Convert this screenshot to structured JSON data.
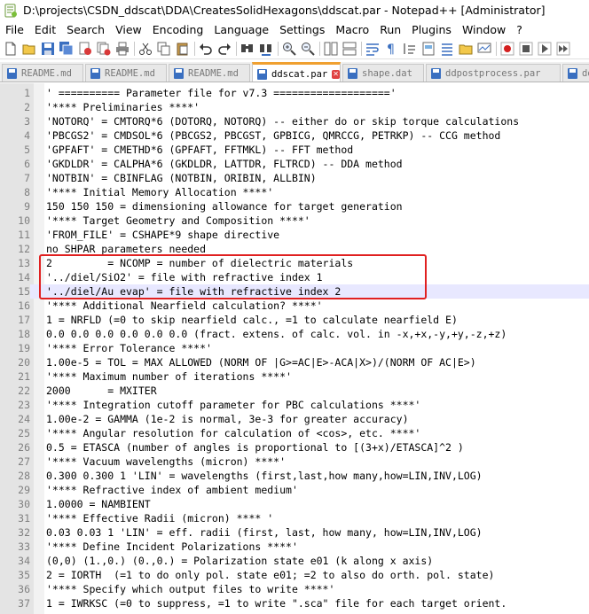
{
  "window": {
    "title": "D:\\projects\\CSDN_ddscat\\DDA\\CreatesSolidHexagons\\ddscat.par - Notepad++ [Administrator]"
  },
  "menu": [
    "File",
    "Edit",
    "Search",
    "View",
    "Encoding",
    "Language",
    "Settings",
    "Macro",
    "Run",
    "Plugins",
    "Window",
    "?"
  ],
  "toolbar": {
    "icons": [
      "new-file-icon",
      "open-file-icon",
      "save-icon",
      "save-all-icon",
      "close-icon",
      "close-all-icon",
      "print-icon",
      "cut-icon",
      "copy-icon",
      "paste-icon",
      "undo-icon",
      "redo-icon",
      "find-icon",
      "replace-icon",
      "zoom-in-icon",
      "zoom-out-icon",
      "sync-vertical-icon",
      "sync-horizontal-icon",
      "word-wrap-icon",
      "show-all-chars-icon",
      "indent-guide-icon",
      "document-map-icon",
      "function-list-icon",
      "folder-workspace-icon",
      "monitoring-icon",
      "record-macro-icon",
      "stop-record-icon",
      "play-macro-icon",
      "run-macro-multiple-icon",
      "save-macro-icon"
    ]
  },
  "tabs": [
    {
      "label": "README.md",
      "active": false
    },
    {
      "label": "README.md",
      "active": false
    },
    {
      "label": "README.md",
      "active": false
    },
    {
      "label": "ddscat.par",
      "active": true
    },
    {
      "label": "shape.dat",
      "active": false
    },
    {
      "label": "ddpostprocess.par",
      "active": false
    },
    {
      "label": "dds",
      "active": false
    }
  ],
  "editor": {
    "current_line": 15,
    "highlight_lines": [
      13,
      14,
      15
    ],
    "lines": [
      {
        "n": "1",
        "text": "' ========== Parameter file for v7.3 ==================='"
      },
      {
        "n": "2",
        "text": "'**** Preliminaries ****'"
      },
      {
        "n": "3",
        "text": "'NOTORQ' = CMTORQ*6 (DOTORQ, NOTORQ) -- either do or skip torque calculations"
      },
      {
        "n": "4",
        "text": "'PBCGS2' = CMDSOL*6 (PBCGS2, PBCGST, GPBICG, QMRCCG, PETRKP) -- CCG method"
      },
      {
        "n": "5",
        "text": "'GPFAFT' = CMETHD*6 (GPFAFT, FFTMKL) -- FFT method"
      },
      {
        "n": "6",
        "text": "'GKDLDR' = CALPHA*6 (GKDLDR, LATTDR, FLTRCD) -- DDA method"
      },
      {
        "n": "7",
        "text": "'NOTBIN' = CBINFLAG (NOTBIN, ORIBIN, ALLBIN)"
      },
      {
        "n": "8",
        "text": "'**** Initial Memory Allocation ****'"
      },
      {
        "n": "9",
        "text": "150 150 150 = dimensioning allowance for target generation"
      },
      {
        "n": "10",
        "text": "'**** Target Geometry and Composition ****'"
      },
      {
        "n": "11",
        "text": "'FROM_FILE' = CSHAPE*9 shape directive"
      },
      {
        "n": "12",
        "text": "no SHPAR parameters needed"
      },
      {
        "n": "13",
        "text": "2         = NCOMP = number of dielectric materials"
      },
      {
        "n": "14",
        "text": "'../diel/SiO2' = file with refractive index 1"
      },
      {
        "n": "15",
        "text": "'../diel/Au evap' = file with refractive index 2"
      },
      {
        "n": "16",
        "text": "'**** Additional Nearfield calculation? ****'"
      },
      {
        "n": "17",
        "text": "1 = NRFLD (=0 to skip nearfield calc., =1 to calculate nearfield E)"
      },
      {
        "n": "18",
        "text": "0.0 0.0 0.0 0.0 0.0 0.0 (fract. extens. of calc. vol. in -x,+x,-y,+y,-z,+z)"
      },
      {
        "n": "19",
        "text": "'**** Error Tolerance ****'"
      },
      {
        "n": "20",
        "text": "1.00e-5 = TOL = MAX ALLOWED (NORM OF |G>=AC|E>-ACA|X>)/(NORM OF AC|E>)"
      },
      {
        "n": "21",
        "text": "'**** Maximum number of iterations ****'"
      },
      {
        "n": "22",
        "text": "2000      = MXITER"
      },
      {
        "n": "23",
        "text": "'**** Integration cutoff parameter for PBC calculations ****'"
      },
      {
        "n": "24",
        "text": "1.00e-2 = GAMMA (1e-2 is normal, 3e-3 for greater accuracy)"
      },
      {
        "n": "25",
        "text": "'**** Angular resolution for calculation of <cos>, etc. ****'"
      },
      {
        "n": "26",
        "text": "0.5 = ETASCA (number of angles is proportional to [(3+x)/ETASCA]^2 )"
      },
      {
        "n": "27",
        "text": "'**** Vacuum wavelengths (micron) ****'"
      },
      {
        "n": "28",
        "text": "0.300 0.300 1 'LIN' = wavelengths (first,last,how many,how=LIN,INV,LOG)"
      },
      {
        "n": "29",
        "text": "'**** Refractive index of ambient medium'"
      },
      {
        "n": "30",
        "text": "1.0000 = NAMBIENT"
      },
      {
        "n": "31",
        "text": "'**** Effective Radii (micron) **** '"
      },
      {
        "n": "32",
        "text": "0.03 0.03 1 'LIN' = eff. radii (first, last, how many, how=LIN,INV,LOG)"
      },
      {
        "n": "33",
        "text": "'**** Define Incident Polarizations ****'"
      },
      {
        "n": "34",
        "text": "(0,0) (1.,0.) (0.,0.) = Polarization state e01 (k along x axis)"
      },
      {
        "n": "35",
        "text": "2 = IORTH  (=1 to do only pol. state e01; =2 to also do orth. pol. state)"
      },
      {
        "n": "36",
        "text": "'**** Specify which output files to write ****'"
      },
      {
        "n": "37",
        "text": "1 = IWRKSC (=0 to suppress, =1 to write \".sca\" file for each target orient."
      }
    ]
  }
}
